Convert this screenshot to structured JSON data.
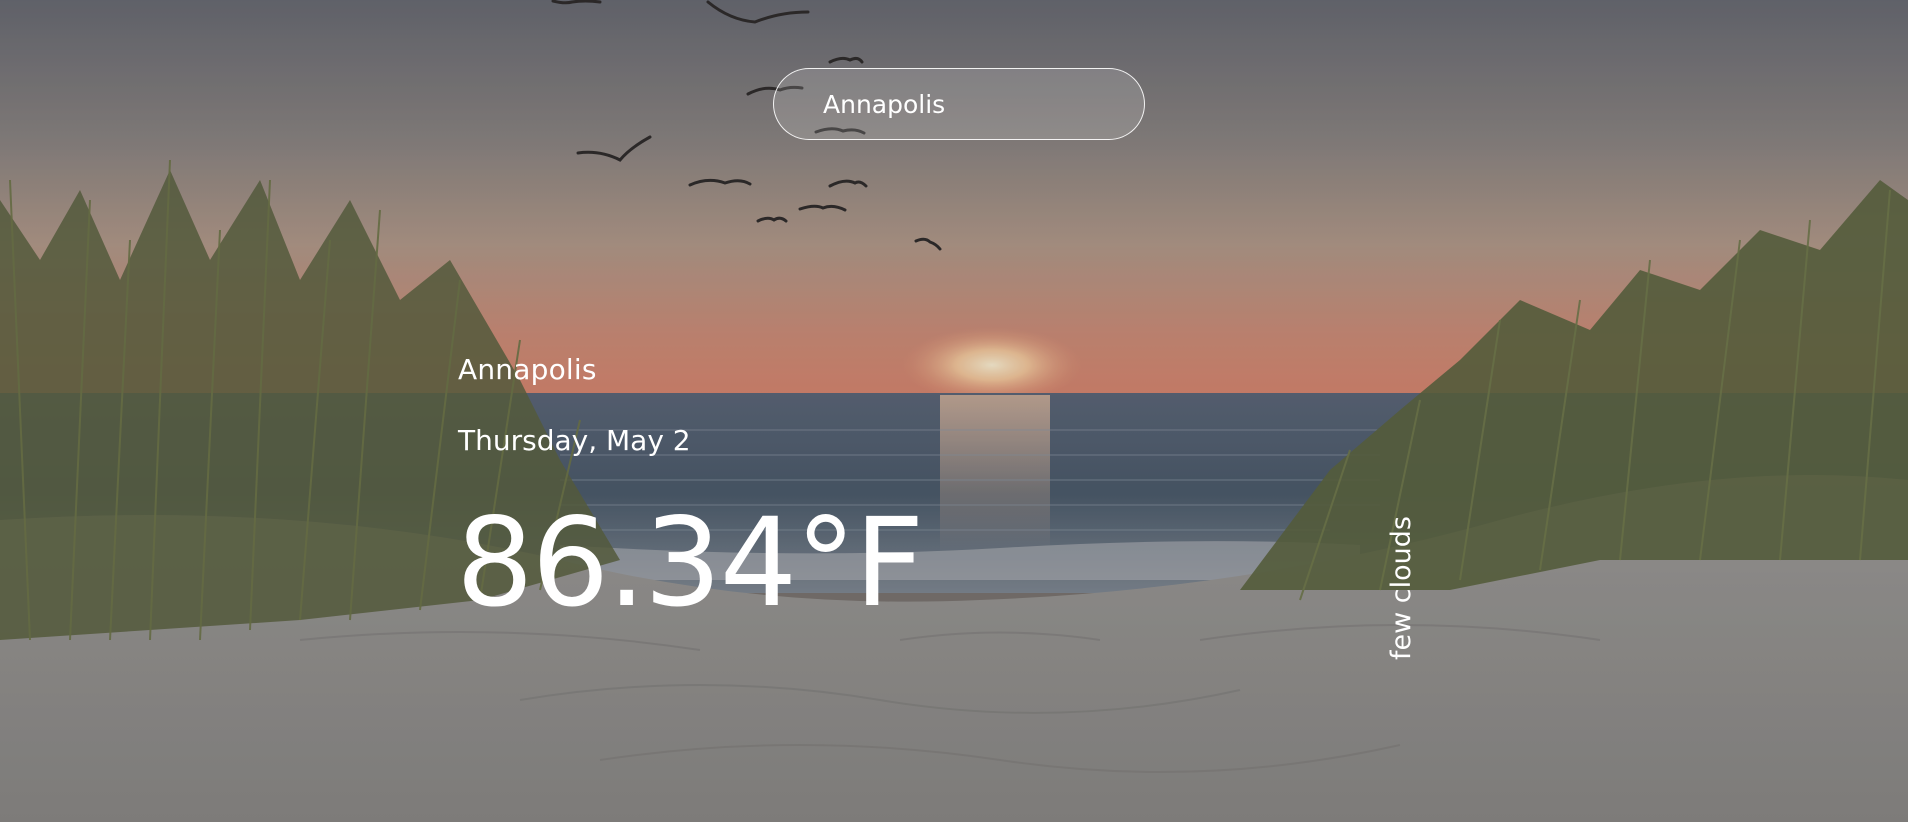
{
  "search": {
    "value": "Annapolis",
    "placeholder": ""
  },
  "weather": {
    "city": "Annapolis",
    "date": "Thursday, May 2",
    "temperature": "86.34°F",
    "description": "few clouds"
  },
  "colors": {
    "text": "#ffffff",
    "sky_top": "#6d6f78",
    "sunset_glow": "#d58a72",
    "sea": "#4d5b6a",
    "sand": "#a5a3a0",
    "grass": "#5f6a3e"
  }
}
